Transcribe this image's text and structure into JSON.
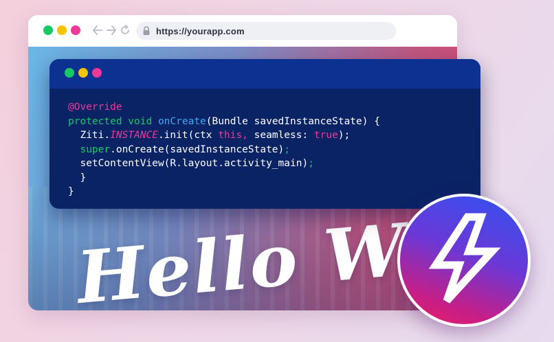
{
  "browser": {
    "url": "https://yourapp.com",
    "traffic_lights": [
      "#17c964",
      "#f5c400",
      "#f0389a"
    ],
    "nav_icons": [
      "arrow-left-icon",
      "arrow-right-icon",
      "reload-icon"
    ],
    "lock_icon": "lock-icon"
  },
  "hero": {
    "text": "Hello World"
  },
  "code_window": {
    "traffic_lights": [
      "#17c964",
      "#f5c400",
      "#f0389a"
    ],
    "lines": [
      [
        {
          "t": "@Override",
          "c": "annotation"
        }
      ],
      [
        {
          "t": "protected void ",
          "c": "keyword"
        },
        {
          "t": "onCreate",
          "c": "method"
        },
        {
          "t": "(Bundle savedInstanceState) {",
          "c": "plain"
        }
      ],
      [
        {
          "t": "  Ziti.",
          "c": "plain"
        },
        {
          "t": "INSTANCE",
          "c": "field"
        },
        {
          "t": ".init(ctx ",
          "c": "plain"
        },
        {
          "t": "this,",
          "c": "this"
        },
        {
          "t": " seamless: ",
          "c": "plain"
        },
        {
          "t": "true",
          "c": "bool"
        },
        {
          "t": ");",
          "c": "plain"
        }
      ],
      [
        {
          "t": "  super",
          "c": "keyword"
        },
        {
          "t": ".onCreate(savedInstanceState)",
          "c": "plain"
        },
        {
          "t": ";",
          "c": "semicolon"
        }
      ],
      [
        {
          "t": "  setContentView(R.layout.activity_main)",
          "c": "plain"
        },
        {
          "t": ";",
          "c": "semicolon"
        }
      ],
      [
        {
          "t": "  }",
          "c": "plain"
        }
      ],
      [
        {
          "t": "}",
          "c": "plain"
        }
      ]
    ]
  },
  "badge": {
    "icon": "lightning-bolt-icon"
  }
}
